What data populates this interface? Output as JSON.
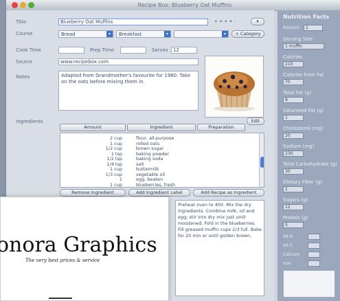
{
  "window": {
    "title": "Recipe Box: Blueberry Oat Muffins",
    "traffic_colors": [
      "#e0443a",
      "#e8a92d",
      "#4fae3c"
    ]
  },
  "form": {
    "title_label": "Title",
    "title_value": "Blueberry Oat Muffins",
    "rating_value": "• • • • ·",
    "course_label": "Course",
    "course_value": "Bread",
    "category_value": "Breakfast",
    "cuisine_value": "",
    "add_category_label": "+ Category",
    "cook_time_label": "Cook Time",
    "prep_time_label": "Prep Time",
    "serves_label": "Serves",
    "serves_value": "12",
    "source_label": "Source",
    "source_value": "www.recipebox.com",
    "notes_label": "Notes",
    "notes_text": "Adapted from Grandmother's favourite for 1980. Take on the oats before mixing them in.",
    "ingredients_label": "Ingredients",
    "ingredients_header": [
      "Amount",
      "Ingredient",
      "Preparation"
    ],
    "ingredients_edit_label": "Edit",
    "ingredients": [
      {
        "amount": "2 cup",
        "name": "flour, all-purpose"
      },
      {
        "amount": "1 cup",
        "name": "rolled oats"
      },
      {
        "amount": "1/2 cup",
        "name": "brown sugar"
      },
      {
        "amount": "1 tsp",
        "name": "baking powder"
      },
      {
        "amount": "1/2 tsp",
        "name": "baking soda"
      },
      {
        "amount": "1/4 tsp",
        "name": "salt"
      },
      {
        "amount": "1 cup",
        "name": "buttermilk"
      },
      {
        "amount": "1/3 cup",
        "name": "vegetable oil"
      },
      {
        "amount": "1",
        "name": "egg, beaten"
      },
      {
        "amount": "1 cup",
        "name": "blueberries, fresh"
      }
    ],
    "button_remove": "Remove Ingredient",
    "button_add": "Add Ingredient Label",
    "button_add_recipe": "Add Recipe as Ingredient",
    "directions_text": "Preheat oven to 400. Mix the dry ingredients. Combine milk, oil and egg; stir into dry mix just until moistened. Fold in the blueberries. Fill greased muffin cups 2/3 full. Bake for 20 min or until golden brown."
  },
  "sidebar": {
    "title": "Nutrition Facts",
    "amount_label": "Amount",
    "amount_value": "1",
    "serving_label": "Serving Size",
    "serving_value": "1 muffin",
    "calories_label": "Calories",
    "calories_value": "210",
    "calories_fat_label": "Calories from Fat",
    "calories_fat_value": "70",
    "total_fat_label": "Total Fat (g)",
    "total_fat_value": "8",
    "sat_fat_label": "Saturated Fat (g)",
    "sat_fat_value": "1",
    "cholesterol_label": "Cholesterol (mg)",
    "cholesterol_value": "20",
    "sodium_label": "Sodium (mg)",
    "sodium_value": "230",
    "carbs_label": "Total Carbohydrate (g)",
    "carbs_value": "30",
    "fiber_label": "Dietary Fiber (g)",
    "fiber_value": "2",
    "sugars_label": "Sugars (g)",
    "sugars_value": "12",
    "protein_label": "Protein (g)",
    "protein_value": "5",
    "extra": [
      "Vit A",
      "Vit C",
      "Calcium",
      "Iron"
    ]
  },
  "logo": {
    "name": "onora Graphics",
    "tagline": "The very best prices & service"
  }
}
